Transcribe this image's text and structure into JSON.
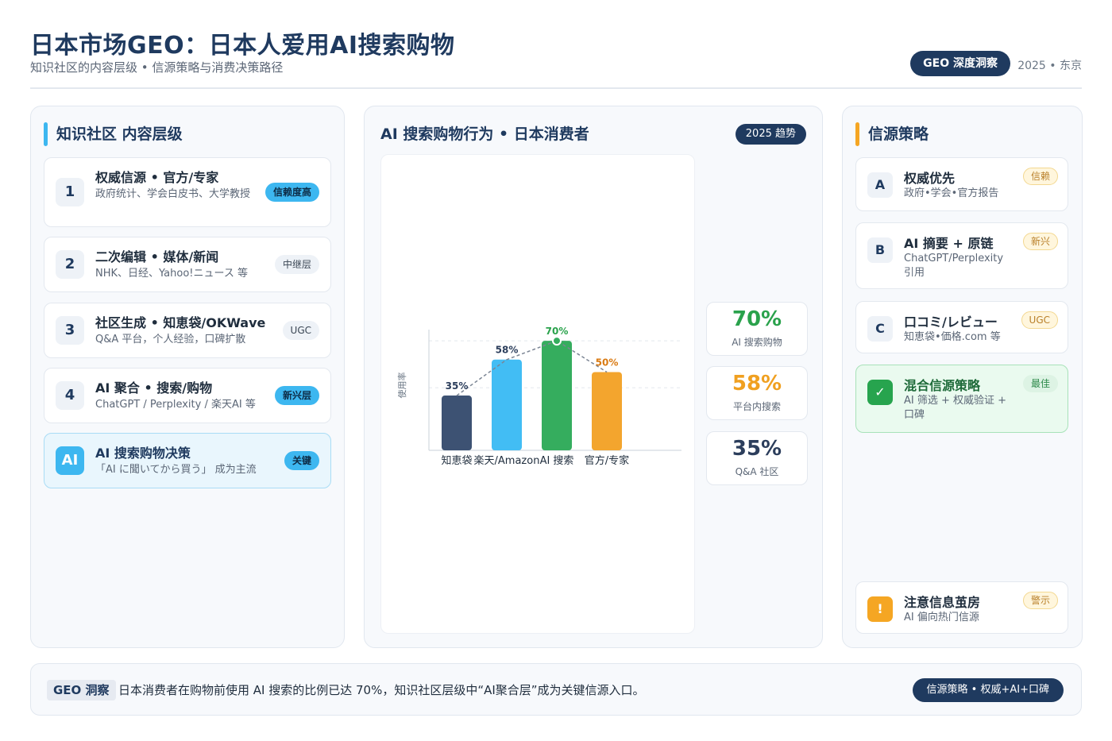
{
  "header": {
    "title": "日本市场GEO：日本人爱用AI搜索购物",
    "subtitle": "知识社区的内容层级 • 信源策略与消费决策路径",
    "brand_pill": "GEO 深度洞察",
    "meta": "2025 • 东京"
  },
  "left": {
    "title": "知识社区 内容层级",
    "items": [
      {
        "num": "1",
        "title": "权威信源 • 官方/专家",
        "sub": "政府统计、学会白皮书、大学教授",
        "tag": "信赖度高"
      },
      {
        "num": "2",
        "title": "二次编辑 • 媒体/新闻",
        "sub": "NHK、日经、Yahoo!ニュース 等",
        "tag": "中继层"
      },
      {
        "num": "3",
        "title": "社区生成 • 知恵袋/OKWave",
        "sub": "Q&A 平台，个人经验，口碑扩散",
        "tag": "UGC"
      },
      {
        "num": "4",
        "title": "AI 聚合 • 搜索/购物",
        "sub": "ChatGPT / Perplexity / 楽天AI 等",
        "tag": "新兴层"
      },
      {
        "num": "AI",
        "title": "AI 搜索购物决策",
        "sub": "「AI に聞いてから買う」 成为主流",
        "tag": "关键"
      }
    ]
  },
  "middle": {
    "title": "AI 搜索购物行为 • 日本消费者",
    "pill": "2025 趋势",
    "stats": [
      {
        "value": "70%",
        "label": "AI 搜索购物",
        "color": "#2aa24c"
      },
      {
        "value": "58%",
        "label": "平台内搜索",
        "color": "#f0a020"
      },
      {
        "value": "35%",
        "label": "Q&A 社区",
        "color": "#2c3e5c"
      }
    ]
  },
  "chart_data": {
    "type": "bar",
    "categories": [
      "知恵袋",
      "楽天/Amazon",
      "AI 搜索",
      "官方/专家"
    ],
    "values": [
      35,
      58,
      70,
      50
    ],
    "value_labels": [
      "35%",
      "58%",
      "70%",
      "50%"
    ],
    "colors": [
      "#3d5273",
      "#42bdf4",
      "#35ad5e",
      "#f3a52e"
    ],
    "label_colors": [
      "#2c3e5c",
      "#2c3e5c",
      "#2aa24c",
      "#d97a12"
    ],
    "ylabel": "使用率",
    "ylim": [
      0,
      100
    ],
    "grid": true,
    "trend_line": true
  },
  "right": {
    "title": "信源策略",
    "items": [
      {
        "letter": "A",
        "title": "权威优先",
        "sub": "政府•学会•官方报告",
        "tag": "信赖"
      },
      {
        "letter": "B",
        "title": "AI 摘要 + 原链",
        "sub": "ChatGPT/Perplexity 引用",
        "tag": "新兴"
      },
      {
        "letter": "C",
        "title": "口コミ/レビュー",
        "sub": "知恵袋•価格.com 等",
        "tag": "UGC"
      },
      {
        "letter": "✓",
        "title": "混合信源策略",
        "sub": "AI 筛选 + 权威验证 + 口碑",
        "tag": "最佳"
      },
      {
        "letter": "!",
        "title": "注意信息茧房",
        "sub": "AI 偏向热门信源",
        "tag": "警示"
      }
    ]
  },
  "footer": {
    "tag": "GEO 洞察",
    "text": "日本消费者在购物前使用 AI 搜索的比例已达 70%，知识社区层级中“AI聚合层”成为关键信源入口。",
    "pill": "信源策略 • 权威+AI+口碑"
  }
}
